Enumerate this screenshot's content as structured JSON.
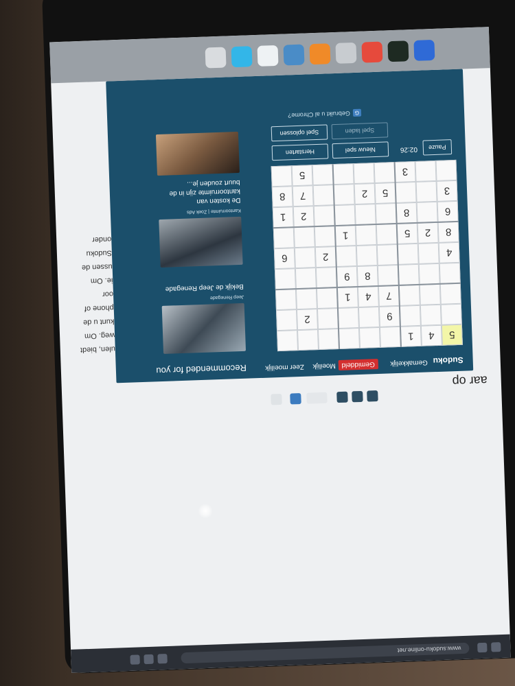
{
  "browser": {
    "url": "www.sudoku-online.net"
  },
  "sudoku": {
    "title": "Sudoku",
    "difficulties": [
      "Gemakkelijk",
      "Gemiddeld",
      "Moeilijk",
      "Zeer moeilijk"
    ],
    "active_difficulty": "Gemiddeld",
    "timer": "02:26",
    "buttons": {
      "pause": "Pauze",
      "new_game": "Nieuw spel",
      "restart": "Herstarten",
      "solve": "Spel oplossen",
      "save": "Spel laden"
    },
    "footer": "Gebruikt u al Chrome?",
    "grid": [
      [
        5,
        4,
        1,
        null,
        null,
        null,
        null,
        null,
        null
      ],
      [
        null,
        null,
        null,
        9,
        null,
        null,
        null,
        2,
        null
      ],
      [
        null,
        null,
        null,
        7,
        4,
        1,
        null,
        null,
        null
      ],
      [
        null,
        null,
        null,
        null,
        8,
        9,
        null,
        null,
        null
      ],
      [
        4,
        null,
        null,
        null,
        null,
        null,
        2,
        null,
        6
      ],
      [
        8,
        2,
        5,
        null,
        null,
        1,
        null,
        null,
        null
      ],
      [
        6,
        null,
        8,
        null,
        null,
        null,
        null,
        2,
        1
      ],
      [
        3,
        null,
        null,
        5,
        2,
        null,
        null,
        7,
        8
      ],
      [
        null,
        null,
        3,
        null,
        null,
        null,
        null,
        5,
        null
      ]
    ]
  },
  "recommended": {
    "title": "Recommended for you",
    "items": [
      {
        "source": "Jeep Renegade",
        "text": "Bekijk de Jeep Renegade"
      },
      {
        "source": "Kantoorruimte | Zoek Ads",
        "text": "De kosten van kantoorruimte zijn in de buurt zouden je..."
      }
    ]
  },
  "article": {
    "heading": "aar op",
    "lines": [
      "ulen, biedt",
      "weg. Om",
      "kunt u de",
      "phone of",
      "oor",
      "ie. Om",
      "ussen de",
      "Sudoku",
      "onder"
    ]
  },
  "colors": {
    "panel": "#1b4f6b",
    "active_tab": "#d32f2f",
    "selected_cell": "#f3f6a8"
  }
}
